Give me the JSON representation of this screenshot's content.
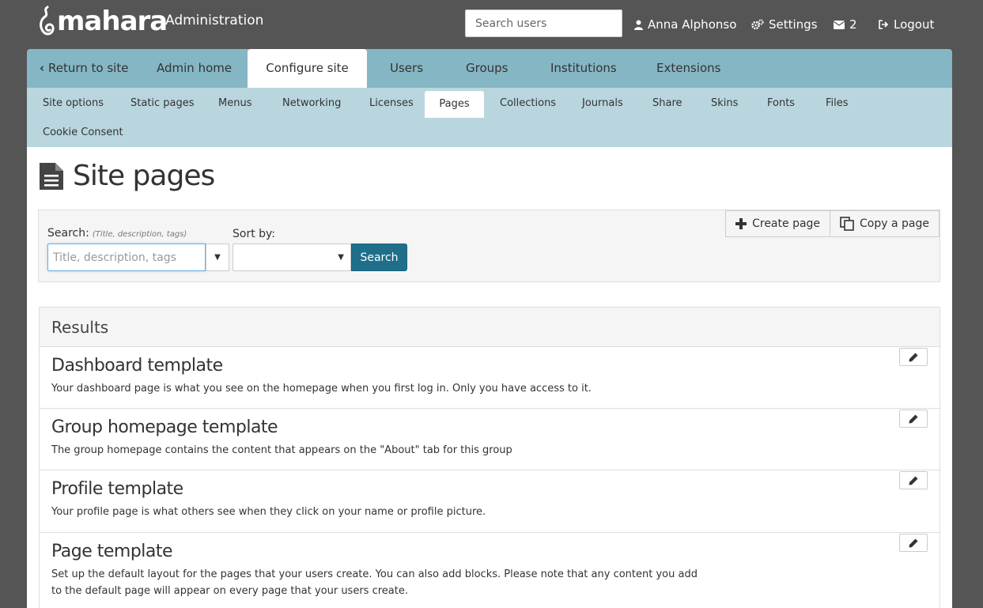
{
  "header": {
    "logo_text": "mahara",
    "site_label": "Administration",
    "search_placeholder": "Search users",
    "user_name": "Anna Alphonso",
    "settings_label": "Settings",
    "messages_count": "2",
    "logout_label": "Logout"
  },
  "main_nav": {
    "return_label": "Return to site",
    "items": [
      "Admin home",
      "Configure site",
      "Users",
      "Groups",
      "Institutions",
      "Extensions"
    ],
    "active": "Configure site"
  },
  "sub_nav": {
    "items": [
      "Site options",
      "Static pages",
      "Menus",
      "Networking",
      "Licenses",
      "Pages",
      "Collections",
      "Journals",
      "Share",
      "Skins",
      "Fonts",
      "Files",
      "Cookie Consent"
    ],
    "active": "Pages"
  },
  "page": {
    "title": "Site pages"
  },
  "search": {
    "label": "Search:",
    "hint": "(Title, description, tags)",
    "placeholder": "Title, description, tags",
    "sort_label": "Sort by:",
    "sort_value": "",
    "button_label": "Search"
  },
  "actions": {
    "create_label": "Create page",
    "copy_label": "Copy a page"
  },
  "results": {
    "heading": "Results",
    "items": [
      {
        "title": "Dashboard template",
        "description": "Your dashboard page is what you see on the homepage when you first log in. Only you have access to it."
      },
      {
        "title": "Group homepage template",
        "description": "The group homepage contains the content that appears on the \"About\" tab for this group"
      },
      {
        "title": "Profile template",
        "description": "Your profile page is what others see when they click on your name or profile picture."
      },
      {
        "title": "Page template",
        "description": "Set up the default layout for the pages that your users create. You can also add blocks. Please note that any content you add to the default page will appear on every page that your users create."
      }
    ]
  },
  "colors": {
    "header_bg": "#555555",
    "main_nav_bg": "#85b6c4",
    "sub_nav_bg": "#b9d6de",
    "primary_button": "#1f6f8b"
  }
}
